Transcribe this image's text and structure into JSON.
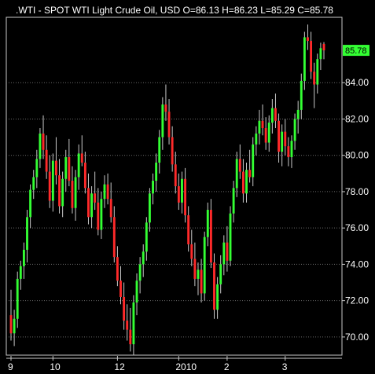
{
  "chart_data": {
    "type": "candlestick",
    "title": ".WTI - SPOT WTI Light Crude Oil, USD O=86.13 H=86.23 L=85.29 C=85.78",
    "last_price_label": "85.78",
    "ylim": [
      69.0,
      87.6
    ],
    "y_ticks": [
      "70.00",
      "72.00",
      "74.00",
      "76.00",
      "78.00",
      "80.00",
      "82.00",
      "84.00"
    ],
    "x_tick_labels": [
      "9",
      "10",
      "12",
      "2010",
      "2",
      "3"
    ],
    "grid": true,
    "colors": {
      "up": "#33ff33",
      "down": "#ff2a2a",
      "wick": "#c8c8c8",
      "background": "#000000"
    },
    "ohlc": [
      [
        71.2,
        72.6,
        69.8,
        70.2
      ],
      [
        70.2,
        71.5,
        69.5,
        71.0
      ],
      [
        71.0,
        73.6,
        70.5,
        73.2
      ],
      [
        73.2,
        74.2,
        72.6,
        73.9
      ],
      [
        73.9,
        75.2,
        73.2,
        74.8
      ],
      [
        74.8,
        77.0,
        74.1,
        76.6
      ],
      [
        76.6,
        78.4,
        76.0,
        78.1
      ],
      [
        78.1,
        79.2,
        77.6,
        78.8
      ],
      [
        78.8,
        80.3,
        78.2,
        79.8
      ],
      [
        79.8,
        81.5,
        79.3,
        81.2
      ],
      [
        81.2,
        82.2,
        79.8,
        80.3
      ],
      [
        80.3,
        81.1,
        78.7,
        79.1
      ],
      [
        79.1,
        80.0,
        77.1,
        77.5
      ],
      [
        77.5,
        80.1,
        76.9,
        79.7
      ],
      [
        79.7,
        81.0,
        78.4,
        78.9
      ],
      [
        78.9,
        79.8,
        76.8,
        77.2
      ],
      [
        77.2,
        79.1,
        76.6,
        78.7
      ],
      [
        78.7,
        80.3,
        78.0,
        79.9
      ],
      [
        79.9,
        80.9,
        78.3,
        78.6
      ],
      [
        78.6,
        79.4,
        76.8,
        77.1
      ],
      [
        77.1,
        79.2,
        76.4,
        78.8
      ],
      [
        78.8,
        80.6,
        78.1,
        80.1
      ],
      [
        80.1,
        81.1,
        79.4,
        79.6
      ],
      [
        79.6,
        80.2,
        77.9,
        78.2
      ],
      [
        78.2,
        79.0,
        76.2,
        76.6
      ],
      [
        76.6,
        78.3,
        76.0,
        77.9
      ],
      [
        77.9,
        79.1,
        77.0,
        77.4
      ],
      [
        77.4,
        78.2,
        75.6,
        75.9
      ],
      [
        75.9,
        78.0,
        75.4,
        77.6
      ],
      [
        77.6,
        78.9,
        77.1,
        78.4
      ],
      [
        78.4,
        79.0,
        77.3,
        77.6
      ],
      [
        77.6,
        78.5,
        76.3,
        76.6
      ],
      [
        76.6,
        77.2,
        74.1,
        74.4
      ],
      [
        74.4,
        75.0,
        72.8,
        73.1
      ],
      [
        73.1,
        73.9,
        71.8,
        72.2
      ],
      [
        72.2,
        73.0,
        70.4,
        70.9
      ],
      [
        70.9,
        71.8,
        69.8,
        70.4
      ],
      [
        70.4,
        71.6,
        69.2,
        69.6
      ],
      [
        69.6,
        72.3,
        69.0,
        71.9
      ],
      [
        71.9,
        73.5,
        71.2,
        73.1
      ],
      [
        73.1,
        74.4,
        72.4,
        74.0
      ],
      [
        74.0,
        75.1,
        73.3,
        74.7
      ],
      [
        74.7,
        76.6,
        74.2,
        76.3
      ],
      [
        76.3,
        78.2,
        75.8,
        77.9
      ],
      [
        77.9,
        79.0,
        77.3,
        78.6
      ],
      [
        78.6,
        80.1,
        78.0,
        79.6
      ],
      [
        79.6,
        81.4,
        79.0,
        81.0
      ],
      [
        81.0,
        83.2,
        80.3,
        82.8
      ],
      [
        82.8,
        83.9,
        81.9,
        82.4
      ],
      [
        82.4,
        83.1,
        80.6,
        81.0
      ],
      [
        81.0,
        81.6,
        79.1,
        79.5
      ],
      [
        79.5,
        80.2,
        77.9,
        78.3
      ],
      [
        78.3,
        79.0,
        77.0,
        77.4
      ],
      [
        77.4,
        79.1,
        76.8,
        78.7
      ],
      [
        78.7,
        79.3,
        76.3,
        76.7
      ],
      [
        76.7,
        77.2,
        74.7,
        75.1
      ],
      [
        75.1,
        75.9,
        73.9,
        74.3
      ],
      [
        74.3,
        75.2,
        72.8,
        73.2
      ],
      [
        73.2,
        74.1,
        72.3,
        73.7
      ],
      [
        73.7,
        74.3,
        71.9,
        72.4
      ],
      [
        72.4,
        75.8,
        72.0,
        75.5
      ],
      [
        75.5,
        77.4,
        75.0,
        77.0
      ],
      [
        77.0,
        77.6,
        73.8,
        74.1
      ],
      [
        74.1,
        74.6,
        71.0,
        71.5
      ],
      [
        71.5,
        73.3,
        71.0,
        72.9
      ],
      [
        72.9,
        74.5,
        72.4,
        74.0
      ],
      [
        74.0,
        75.6,
        73.4,
        75.2
      ],
      [
        75.2,
        76.1,
        73.6,
        74.2
      ],
      [
        74.2,
        77.2,
        73.9,
        76.8
      ],
      [
        76.8,
        78.6,
        76.3,
        78.2
      ],
      [
        78.2,
        80.2,
        77.7,
        79.8
      ],
      [
        79.8,
        80.6,
        78.7,
        79.1
      ],
      [
        79.1,
        79.8,
        77.4,
        77.9
      ],
      [
        77.9,
        79.6,
        77.4,
        79.2
      ],
      [
        79.2,
        80.3,
        78.5,
        78.8
      ],
      [
        78.8,
        81.0,
        78.3,
        80.6
      ],
      [
        80.6,
        81.6,
        80.0,
        81.2
      ],
      [
        81.2,
        82.5,
        80.6,
        81.9
      ],
      [
        81.9,
        82.8,
        81.1,
        81.5
      ],
      [
        81.5,
        82.1,
        80.3,
        80.7
      ],
      [
        80.7,
        82.2,
        80.2,
        81.8
      ],
      [
        81.8,
        83.1,
        81.2,
        82.6
      ],
      [
        82.6,
        83.4,
        81.5,
        81.9
      ],
      [
        81.9,
        82.3,
        79.6,
        80.2
      ],
      [
        80.2,
        81.7,
        79.4,
        81.3
      ],
      [
        81.3,
        82.0,
        80.0,
        80.5
      ],
      [
        80.5,
        81.0,
        79.4,
        79.9
      ],
      [
        79.9,
        81.1,
        79.3,
        80.8
      ],
      [
        80.8,
        82.3,
        80.3,
        82.0
      ],
      [
        82.0,
        83.0,
        81.2,
        82.5
      ],
      [
        82.5,
        84.5,
        82.0,
        84.1
      ],
      [
        84.1,
        86.8,
        83.6,
        86.5
      ],
      [
        86.5,
        87.2,
        85.8,
        86.3
      ],
      [
        86.3,
        86.8,
        84.2,
        84.6
      ],
      [
        84.6,
        85.1,
        82.6,
        83.9
      ],
      [
        83.9,
        85.6,
        83.4,
        85.3
      ],
      [
        85.3,
        86.2,
        84.7,
        85.9
      ],
      [
        86.13,
        86.23,
        85.29,
        85.78
      ]
    ]
  }
}
